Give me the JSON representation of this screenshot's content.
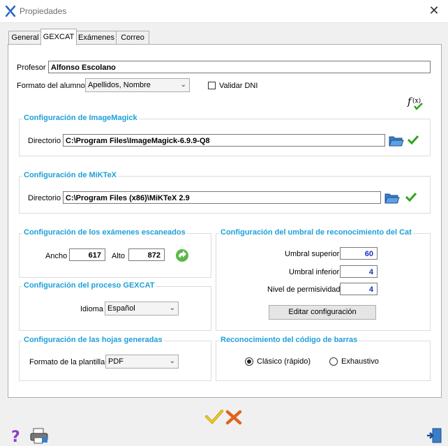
{
  "window": {
    "title": "Propiedades",
    "close": "✕"
  },
  "tabs": [
    {
      "label": "General"
    },
    {
      "label": "GEXCAT"
    },
    {
      "label": "Exámenes"
    },
    {
      "label": "Correo"
    }
  ],
  "active_tab": "GEXCAT",
  "profesor": {
    "label": "Profesor",
    "value": "Alfonso Escolano"
  },
  "formato_alumno": {
    "label": "Formato del alumno",
    "value": "Apellidos, Nombre"
  },
  "validar_dni": {
    "label": "Validar DNI",
    "checked": false
  },
  "imagemagick": {
    "title": "Configuración de ImageMagick",
    "dir_label": "Directorio",
    "dir_value": "C:\\Program Files\\ImageMagick-6.9.9-Q8"
  },
  "miktex": {
    "title": "Configuración de MiKTeX",
    "dir_label": "Directorio",
    "dir_value": "C:\\Program Files (x86)\\MiKTeX 2.9"
  },
  "escaneados": {
    "title": "Configuración de los exámenes escaneados",
    "ancho_label": "Ancho",
    "ancho": "617",
    "alto_label": "Alto",
    "alto": "872"
  },
  "umbral": {
    "title": "Configuración del umbral de reconocimiento del Cat",
    "superior_label": "Umbral superior",
    "superior": "60",
    "inferior_label": "Umbral inferior",
    "inferior": "4",
    "permisividad_label": "Nivel de permisividad",
    "permisividad": "4",
    "edit_button": "Editar configuración"
  },
  "proceso": {
    "title": "Configuración del proceso GEXCAT",
    "idioma_label": "Idioma",
    "idioma": "Español"
  },
  "hojas": {
    "title": "Configuración de las hojas generadas",
    "plantilla_label": "Formato de la plantilla",
    "plantilla": "PDF"
  },
  "barras": {
    "title": "Reconocimiento del código de barras",
    "opt1": "Clásico (rápido)",
    "opt2": "Exhaustivo",
    "selected": "Clásico (rápido)"
  },
  "colors": {
    "accent": "#1ea0d8",
    "number": "#1a2fc8",
    "ok": "#2fa51a",
    "cancel": "#e0631e"
  }
}
